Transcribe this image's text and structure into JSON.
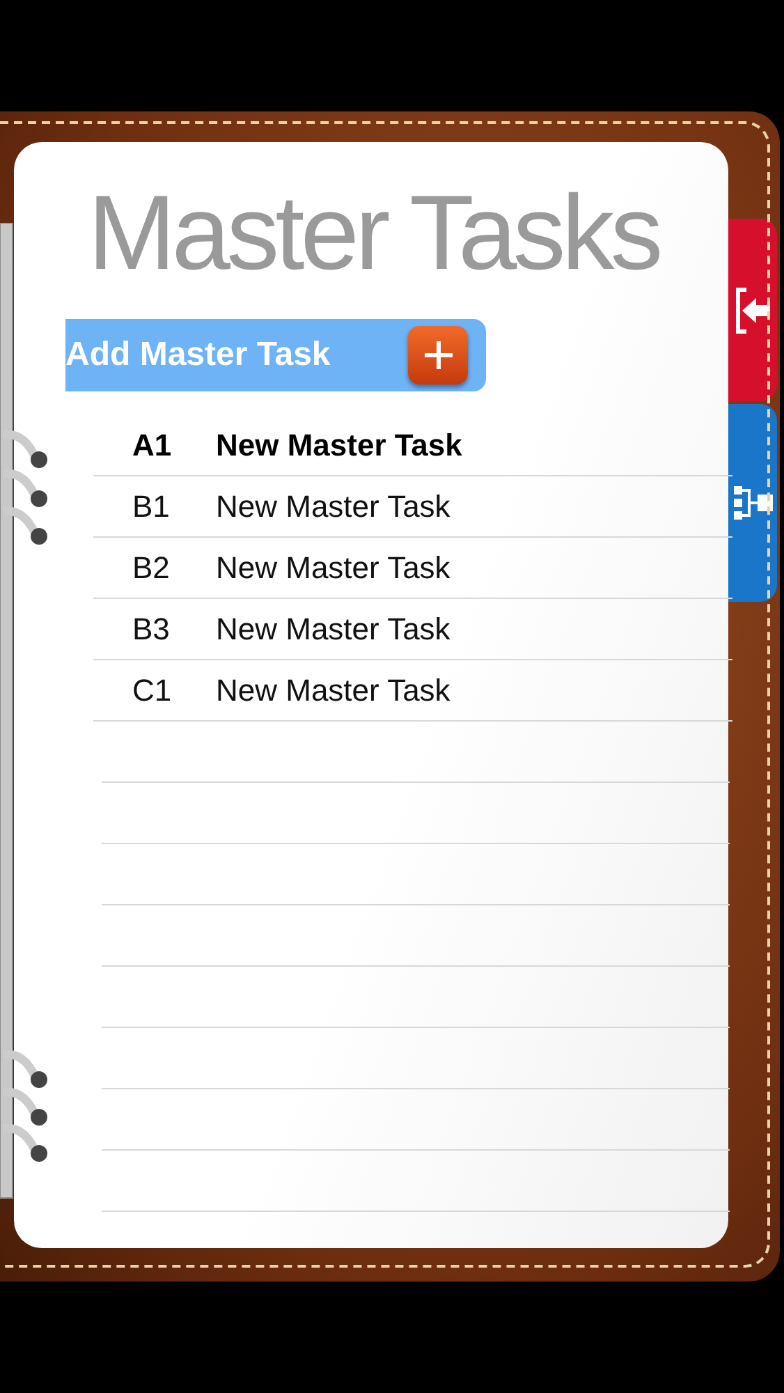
{
  "title": "Master Tasks",
  "add_button": {
    "label": "Add Master Task"
  },
  "tasks": [
    {
      "code": "A1",
      "name": "New Master Task",
      "selected": true
    },
    {
      "code": "B1",
      "name": "New Master Task",
      "selected": false
    },
    {
      "code": "B2",
      "name": "New Master Task",
      "selected": false
    },
    {
      "code": "B3",
      "name": "New Master Task",
      "selected": false
    },
    {
      "code": "C1",
      "name": "New Master Task",
      "selected": false
    }
  ],
  "side_tabs": [
    {
      "kind": "exit",
      "color": "#d6102c"
    },
    {
      "kind": "hierarchy",
      "color": "#1976c9"
    }
  ]
}
